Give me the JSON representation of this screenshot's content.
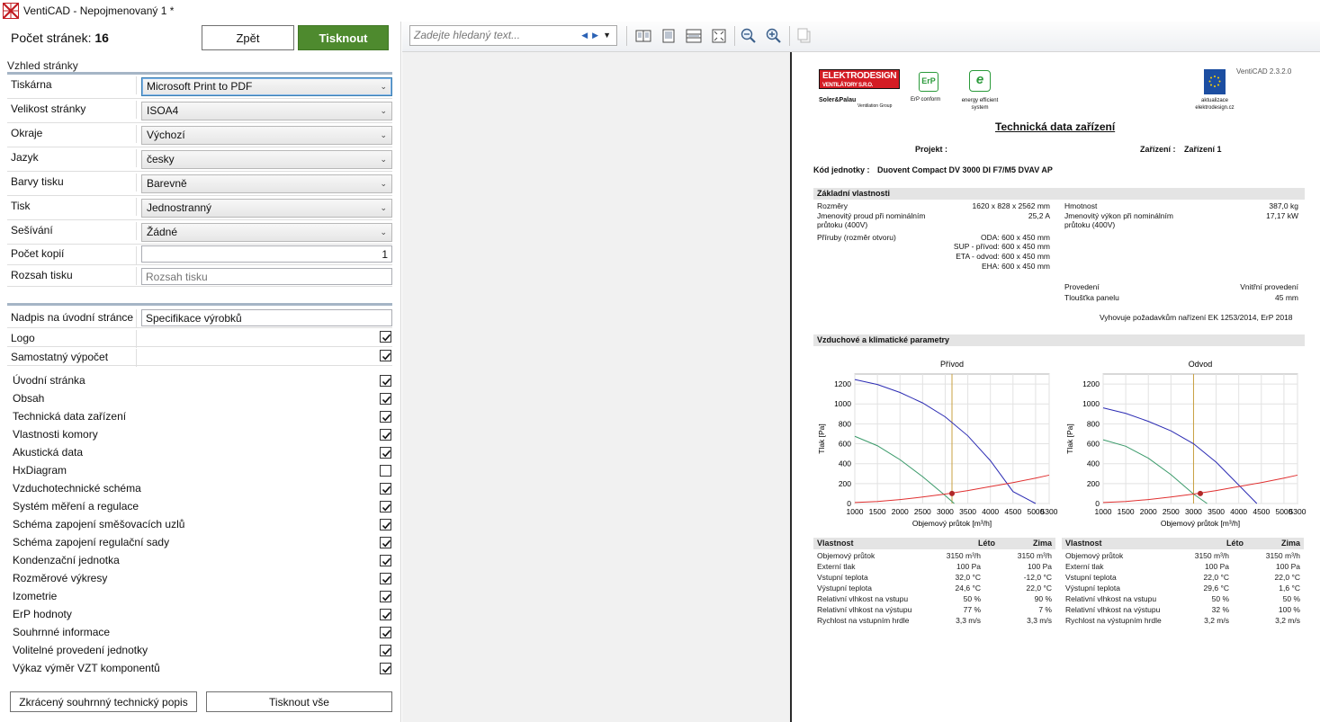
{
  "window": {
    "title": "VentiCAD - Nepojmenovaný 1 *"
  },
  "left": {
    "page_count_label": "Počet stránek:",
    "page_count": "16",
    "back_label": "Zpět",
    "print_label": "Tisknout",
    "section_title": "Vzhled stránky",
    "settings": [
      {
        "label": "Tiskárna",
        "value": "Microsoft Print to PDF"
      },
      {
        "label": "Velikost stránky",
        "value": "ISOA4"
      },
      {
        "label": "Okraje",
        "value": "Výchozí"
      },
      {
        "label": "Jazyk",
        "value": "česky"
      },
      {
        "label": "Barvy tisku",
        "value": "Barevně"
      },
      {
        "label": "Tisk",
        "value": "Jednostranný"
      },
      {
        "label": "Sešívání",
        "value": "Žádné"
      }
    ],
    "copies_label": "Počet kopií",
    "copies_value": "1",
    "range_label": "Rozsah tisku",
    "range_placeholder": "Rozsah tisku",
    "cover_title_label": "Nadpis na úvodní stránce",
    "cover_title_value": "Specifikace výrobků",
    "logo_label": "Logo",
    "logo_checked": true,
    "separate_calc_label": "Samostatný výpočet",
    "separate_calc_checked": true,
    "chapters": [
      {
        "label": "Úvodní stránka",
        "checked": true
      },
      {
        "label": "Obsah",
        "checked": true
      },
      {
        "label": "Technická data zařízení",
        "checked": true
      },
      {
        "label": "Vlastnosti komory",
        "checked": true
      },
      {
        "label": "Akustická data",
        "checked": true
      },
      {
        "label": "HxDiagram",
        "checked": false
      },
      {
        "label": "Vzduchotechnické schéma",
        "checked": true
      },
      {
        "label": "Systém měření a regulace",
        "checked": true
      },
      {
        "label": "Schéma zapojení směšovacích uzlů",
        "checked": true
      },
      {
        "label": "Schéma zapojení regulační sady",
        "checked": true
      },
      {
        "label": "Kondenzační jednotka",
        "checked": true
      },
      {
        "label": "Rozměrové výkresy",
        "checked": true
      },
      {
        "label": "Izometrie",
        "checked": true
      },
      {
        "label": "ErP hodnoty",
        "checked": true
      },
      {
        "label": "Souhrnné informace",
        "checked": true
      },
      {
        "label": "Volitelné provedení jednotky",
        "checked": true
      },
      {
        "label": "Výkaz výměr VZT komponentů",
        "checked": true
      }
    ],
    "short_desc_label": "Zkrácený souhrnný technický popis",
    "print_all_label": "Tisknout vše"
  },
  "toolbar": {
    "search_placeholder": "Zadejte hledaný text...",
    "icons": [
      "two-page-icon",
      "single-page-icon",
      "page-width-icon",
      "whole-page-icon",
      "zoom-out-icon",
      "zoom-in-icon",
      "copy-icon"
    ]
  },
  "document": {
    "version": "VentiCAD 2.3.2.0",
    "logo_text": "ELEKTRODESIGN",
    "logo_sub": "VENTILÁTORY S.R.O.",
    "soler_text": "Soler&Palau",
    "soler_sub": "Ventilation Group",
    "erp_text": "ErP",
    "erp_caption": "ErP conform",
    "e_text": "e",
    "eff_caption": "energy efficient system",
    "update_caption": "aktualizace elektrodesign.cz",
    "heading": "Technická data zařízení",
    "project_label": "Projekt :",
    "device_label": "Zařízení :",
    "device_value": "Zařízení 1",
    "unit_label": "Kód jednotky :",
    "unit_value": "Duovent Compact DV 3000 DI F7/M5 DVAV AP",
    "basic_title": "Základní vlastnosti",
    "basic_left": [
      {
        "label": "Rozměry",
        "value": "1620 x 828 x 2562 mm"
      },
      {
        "label": "Jmenovitý proud při nominálním průtoku (400V)",
        "value": "25,2 A"
      },
      {
        "label": "Příruby (rozměr otvoru)",
        "value": "ODA: 600 x 450 mm"
      },
      {
        "label": "",
        "value": "SUP - přívod: 600 x 450 mm"
      },
      {
        "label": "",
        "value": "ETA - odvod: 600 x 450 mm"
      },
      {
        "label": "",
        "value": "EHA: 600 x 450 mm"
      }
    ],
    "basic_right": [
      {
        "label": "Hmotnost",
        "value": "387,0 kg"
      },
      {
        "label": "Jmenovitý výkon při nominálním průtoku (400V)",
        "value": "17,17 kW"
      },
      {
        "label": "Provedení",
        "value": "Vnitřní provedení"
      },
      {
        "label": "Tloušťka panelu",
        "value": "45 mm"
      }
    ],
    "compliance": "Vyhovuje požadavkům nařízení EK 1253/2014, ErP 2018",
    "air_title": "Vzduchové a klimatické parametry",
    "table_headers": [
      "Vlastnost",
      "Léto",
      "Zima"
    ],
    "supply_table": [
      [
        "Objemový průtok",
        "3150 m³/h",
        "3150 m³/h"
      ],
      [
        "Externí tlak",
        "100 Pa",
        "100 Pa"
      ],
      [
        "Vstupní teplota",
        "32,0 °C",
        "-12,0 °C"
      ],
      [
        "Výstupní teplota",
        "24,6 °C",
        "22,0 °C"
      ],
      [
        "Relativní vlhkost na vstupu",
        "50 %",
        "90 %"
      ],
      [
        "Relativní vlhkost na výstupu",
        "77 %",
        "7 %"
      ],
      [
        "Rychlost na vstupním hrdle",
        "3,3 m/s",
        "3,3 m/s"
      ]
    ],
    "exhaust_table": [
      [
        "Objemový průtok",
        "3150 m³/h",
        "3150 m³/h"
      ],
      [
        "Externí tlak",
        "100 Pa",
        "100 Pa"
      ],
      [
        "Vstupní teplota",
        "22,0 °C",
        "22,0 °C"
      ],
      [
        "Výstupní teplota",
        "29,6 °C",
        "1,6 °C"
      ],
      [
        "Relativní vlhkost na vstupu",
        "50 %",
        "50 %"
      ],
      [
        "Relativní vlhkost na výstupu",
        "32 %",
        "100 %"
      ],
      [
        "Rychlost na výstupním hrdle",
        "3,2 m/s",
        "3,2 m/s"
      ]
    ]
  },
  "chart_data": [
    {
      "type": "line",
      "title": "Přívod",
      "xlabel": "Objemový průtok [m³/h]",
      "ylabel": "Tlak [Pa]",
      "xlim": [
        1000,
        5300
      ],
      "ylim": [
        0,
        1300
      ],
      "xticks": [
        "1000",
        "1500",
        "2000",
        "2500",
        "3000",
        "3500",
        "4000",
        "4500",
        "5000",
        "5300"
      ],
      "yticks": [
        "0",
        "200",
        "400",
        "600",
        "800",
        "1000",
        "1200"
      ],
      "grid": true,
      "colors": {
        "max": "#2b2bb3",
        "work": "#3a9a6a",
        "system": "#e03030",
        "line": "#c9a040",
        "point": "#b02828"
      },
      "series": [
        {
          "x": [
            1000,
            1500,
            2000,
            2500,
            3000,
            3500,
            4000,
            4500,
            5000
          ],
          "values": [
            1245,
            1195,
            1115,
            1010,
            870,
            680,
            430,
            120,
            0
          ]
        },
        {
          "x": [
            1000,
            1500,
            2000,
            2500,
            3000,
            3200
          ],
          "values": [
            675,
            580,
            440,
            270,
            80,
            0
          ]
        },
        {
          "x": [
            1000,
            1500,
            2000,
            2500,
            3000,
            3500,
            4000,
            4500,
            5000,
            5300
          ],
          "values": [
            10,
            20,
            40,
            65,
            95,
            130,
            170,
            210,
            255,
            285
          ]
        }
      ],
      "marker_x": 3150,
      "operating_point": {
        "x": 3150,
        "y": 100
      }
    },
    {
      "type": "line",
      "title": "Odvod",
      "xlabel": "Objemový průtok [m³/h]",
      "ylabel": "Tlak [Pa]",
      "xlim": [
        1000,
        5300
      ],
      "ylim": [
        0,
        1300
      ],
      "xticks": [
        "1000",
        "1500",
        "2000",
        "2500",
        "3000",
        "3500",
        "4000",
        "4500",
        "5000",
        "5300"
      ],
      "yticks": [
        "0",
        "200",
        "400",
        "600",
        "800",
        "1000",
        "1200"
      ],
      "grid": true,
      "colors": {
        "max": "#2b2bb3",
        "work": "#3a9a6a",
        "system": "#e03030",
        "line": "#c9a040",
        "point": "#b02828"
      },
      "series": [
        {
          "x": [
            1000,
            1500,
            2000,
            2500,
            3000,
            3500,
            4000,
            4400
          ],
          "values": [
            960,
            905,
            825,
            730,
            600,
            415,
            185,
            0
          ]
        },
        {
          "x": [
            1000,
            1500,
            2000,
            2500,
            3000,
            3300
          ],
          "values": [
            640,
            575,
            455,
            290,
            95,
            0
          ]
        },
        {
          "x": [
            1000,
            1500,
            2000,
            2500,
            3000,
            3500,
            4000,
            4500,
            5000,
            5300
          ],
          "values": [
            10,
            20,
            40,
            65,
            95,
            130,
            170,
            210,
            255,
            285
          ]
        }
      ],
      "marker_x": 3000,
      "operating_point": {
        "x": 3150,
        "y": 100
      }
    }
  ]
}
